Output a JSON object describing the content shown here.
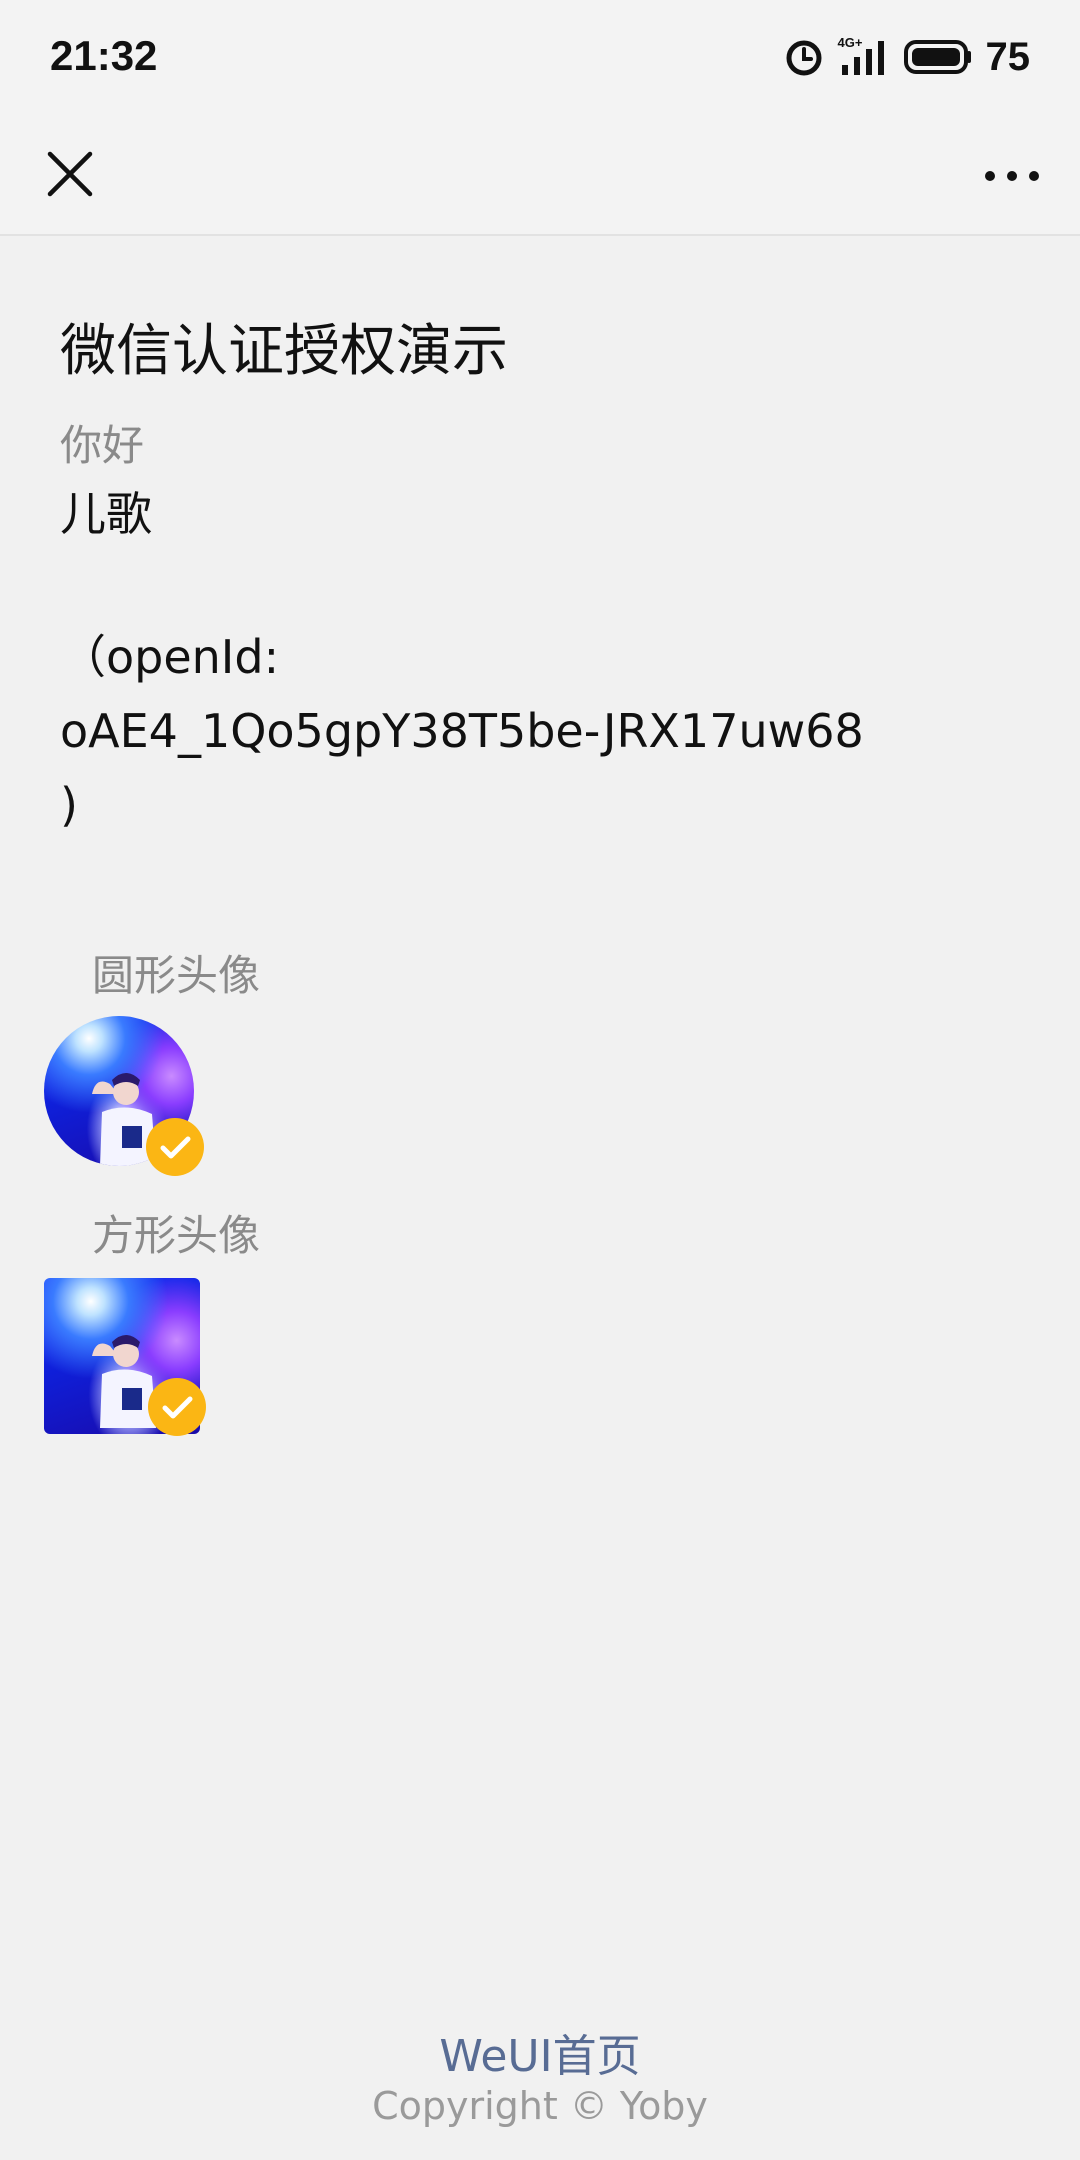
{
  "status_bar": {
    "time": "21:32",
    "alarm_icon": "alarm-clock-icon",
    "network_label": "4G+",
    "signal_icon": "cell-signal-icon",
    "battery_icon": "battery-icon",
    "battery_level": "75"
  },
  "nav": {
    "close_icon": "close-icon",
    "more_icon": "more-dots-icon"
  },
  "main": {
    "title": "微信认证授权演示",
    "greeting": "你好",
    "username": "儿歌",
    "openid_prefix": "（openId:",
    "openid_value": "oAE4_1Qo5gpY38T5be-JRX17uw68",
    "openid_suffix": ")",
    "round_avatar_label": "圆形头像",
    "square_avatar_label": "方形头像"
  },
  "footer": {
    "link": "WeUI首页",
    "copyright": "Copyright © Yoby"
  },
  "colors": {
    "background": "#f1f1f1",
    "badge": "#fbb614",
    "link": "#586c94",
    "muted": "#8a8a8a"
  }
}
